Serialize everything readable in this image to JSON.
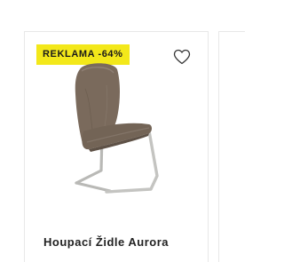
{
  "product": {
    "badge_text": "REKLAMA -64%",
    "title": "Houpací Židle Aurora",
    "image_alt": "Houpací Židle Aurora",
    "wishlist_icon": "heart-outline-icon",
    "colors": {
      "badge_bg": "#f3e81a",
      "seat_fabric": "#7a6a5c",
      "frame": "#b9b9b6"
    }
  }
}
